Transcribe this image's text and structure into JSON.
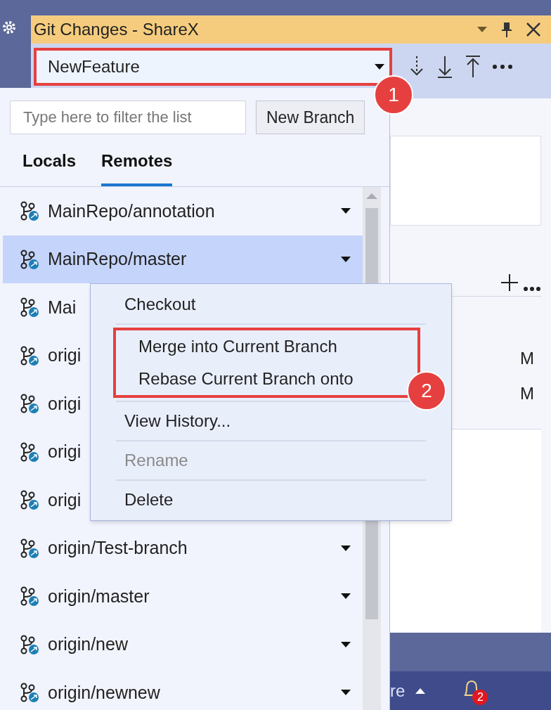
{
  "window": {
    "title": "Git Changes - ShareX"
  },
  "branch_selector": {
    "value": "NewFeature"
  },
  "branch_popup": {
    "filter": {
      "placeholder": "Type here to filter the list"
    },
    "new_branch_button": "New Branch",
    "tabs": [
      {
        "label": "Locals",
        "selected": false
      },
      {
        "label": "Remotes",
        "selected": true
      }
    ],
    "branches": [
      {
        "name": "MainRepo/annotation",
        "selected": false
      },
      {
        "name": "MainRepo/master",
        "selected": true
      },
      {
        "name": "Mai",
        "selected": false
      },
      {
        "name": "origi",
        "selected": false
      },
      {
        "name": "origi",
        "selected": false
      },
      {
        "name": "origi",
        "selected": false
      },
      {
        "name": "origi",
        "selected": false
      },
      {
        "name": "origin/Test-branch",
        "selected": false
      },
      {
        "name": "origin/master",
        "selected": false
      },
      {
        "name": "origin/new",
        "selected": false
      },
      {
        "name": "origin/newnew",
        "selected": false
      }
    ]
  },
  "context_menu": {
    "items": [
      {
        "label": "Checkout",
        "disabled": false,
        "highlighted": false
      },
      {
        "label": "Merge into Current Branch",
        "disabled": false,
        "highlighted": true
      },
      {
        "label": "Rebase Current Branch onto",
        "disabled": false,
        "highlighted": true
      },
      {
        "label": "View History...",
        "disabled": false,
        "highlighted": false
      },
      {
        "label": "Rename",
        "disabled": true,
        "highlighted": false
      },
      {
        "label": "Delete",
        "disabled": false,
        "highlighted": false
      }
    ]
  },
  "changes": {
    "statuses": [
      "M",
      "M"
    ]
  },
  "callouts": [
    "1",
    "2"
  ],
  "status_bar": {
    "text": "re",
    "notifications": "2"
  }
}
